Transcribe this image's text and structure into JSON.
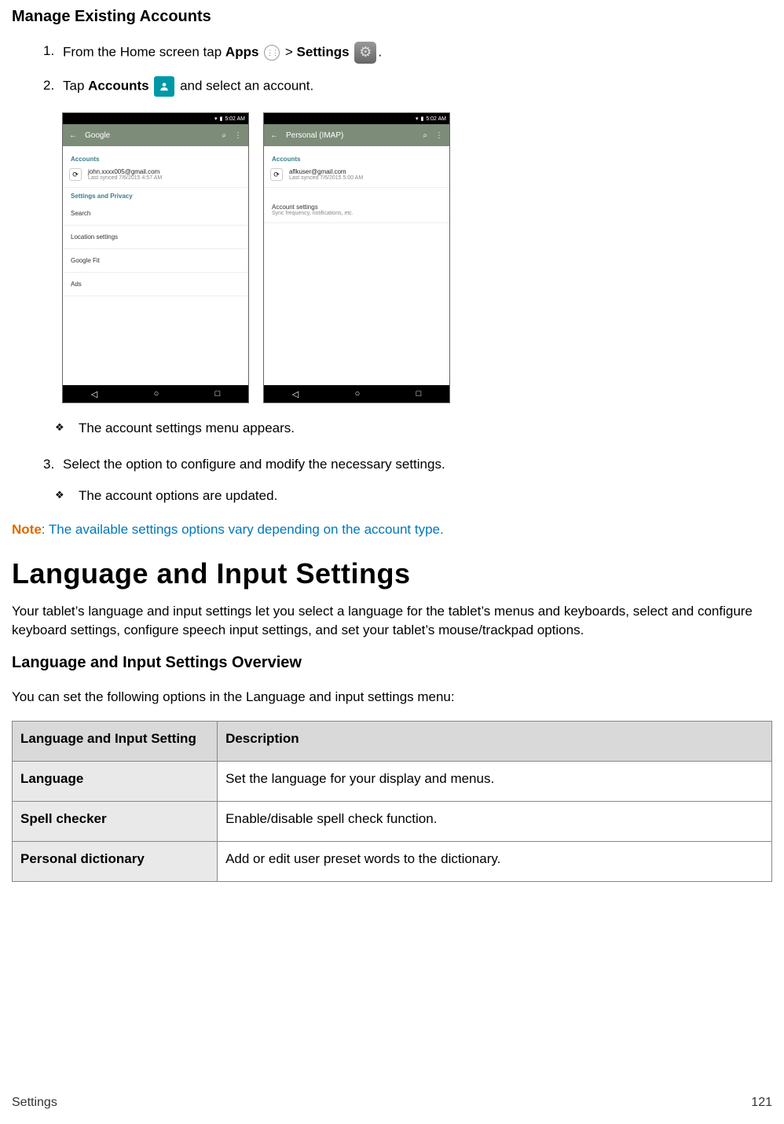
{
  "heading1": "Manage Existing Accounts",
  "step1": {
    "prefix": "From the Home screen tap ",
    "apps": "Apps",
    "gt": " > ",
    "settings": "Settings",
    "suffix": "."
  },
  "step2": {
    "prefix": "Tap ",
    "accounts": "Accounts",
    "suffix": " and select an account."
  },
  "phones": {
    "left": {
      "time": "5:02 AM",
      "title": "Google",
      "section1": "Accounts",
      "acctEmail": "john.xxxx005@gmail.com",
      "acctSub": "Last synced 7/6/2015 4:57 AM",
      "section2": "Settings and Privacy",
      "items": [
        "Search",
        "Location settings",
        "Google Fit",
        "Ads"
      ]
    },
    "right": {
      "time": "5:02 AM",
      "title": "Personal (IMAP)",
      "section1": "Accounts",
      "acctEmail": "aflkuser@gmail.com",
      "acctSub": "Last synced 7/6/2015 5:00 AM",
      "row2t": "Account settings",
      "row2s": "Sync frequency, notifications, etc."
    }
  },
  "bullet1": "The account settings menu appears.",
  "step3": "Select the option to configure and modify the necessary settings.",
  "bullet2": "The account options are updated.",
  "note_label": "Note",
  "note_text": ": The available settings options vary depending on the account type.",
  "heading2": "Language and Input Settings",
  "intro": "Your tablet’s language and input settings let you select a language for the tablet’s menus and keyboards, select and configure keyboard settings, configure speech input settings, and set your tablet’s mouse/trackpad options.",
  "heading3": "Language and Input Settings Overview",
  "overview": "You can set the following options in the Language and input settings menu:",
  "table": {
    "h1": "Language and Input Setting",
    "h2": "Description",
    "rows": [
      {
        "k": "Language",
        "v": "Set the language for your display and menus."
      },
      {
        "k": "Spell checker",
        "v": "Enable/disable spell check function."
      },
      {
        "k": "Personal dictionary",
        "v": "Add or edit user preset words to the dictionary."
      }
    ]
  },
  "footer_left": "Settings",
  "footer_right": "121"
}
